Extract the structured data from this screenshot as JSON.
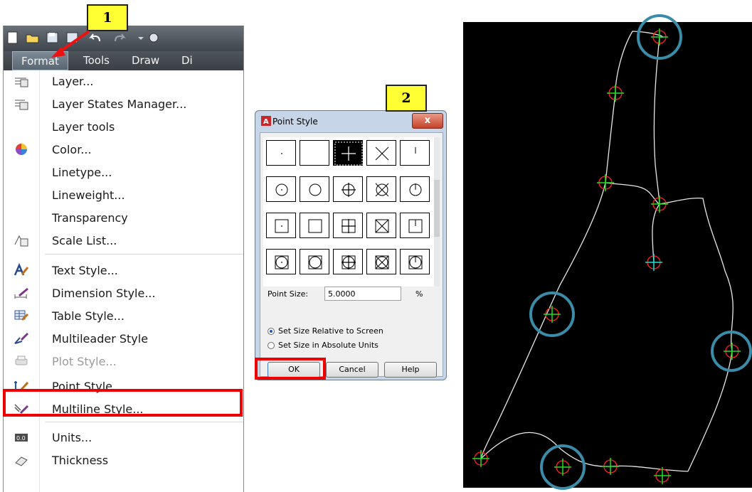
{
  "menu": {
    "menubar": [
      "Format",
      "Tools",
      "Draw",
      "Di"
    ],
    "items": [
      {
        "label": "Layer...",
        "icon": "layer-icon"
      },
      {
        "label": "Layer States Manager...",
        "icon": "layer-states-icon"
      },
      {
        "label": "Layer tools",
        "icon": ""
      },
      {
        "label": "Color...",
        "icon": "color-wheel-icon"
      },
      {
        "label": "Linetype...",
        "icon": ""
      },
      {
        "label": "Lineweight...",
        "icon": ""
      },
      {
        "label": "Transparency",
        "icon": ""
      },
      {
        "label": "Scale List...",
        "icon": "scale-list-icon"
      },
      {
        "label": "Text Style...",
        "icon": "text-style-icon"
      },
      {
        "label": "Dimension Style...",
        "icon": "dimension-style-icon"
      },
      {
        "label": "Table Style...",
        "icon": "table-style-icon"
      },
      {
        "label": "Multileader Style",
        "icon": "multileader-style-icon"
      },
      {
        "label": "Plot Style...",
        "icon": "plot-style-icon"
      },
      {
        "label": "Point Style...",
        "icon": "point-style-icon"
      },
      {
        "label": "Multiline Style...",
        "icon": "multiline-style-icon"
      },
      {
        "label": "Units...",
        "icon": "units-icon"
      },
      {
        "label": "Thickness",
        "icon": "thickness-icon"
      }
    ]
  },
  "callouts": {
    "first": "1",
    "second": "2"
  },
  "dialog": {
    "title": "Point Style",
    "close": "x",
    "point_size_label": "Point Size:",
    "point_size_value": "5.0000",
    "unit": "%",
    "radio_relative": "Set Size Relative to Screen",
    "radio_absolute": "Set Size in Absolute Units",
    "ok": "OK",
    "cancel": "Cancel",
    "help": "Help",
    "selected_style_index": 2
  },
  "colors": {
    "highlight": "#ee0000",
    "callout": "#ffff33",
    "marker_circle": "#ff2020",
    "marker_cross": "#22dd22",
    "ring": "#3a8ca8",
    "canvas": "#000000"
  }
}
